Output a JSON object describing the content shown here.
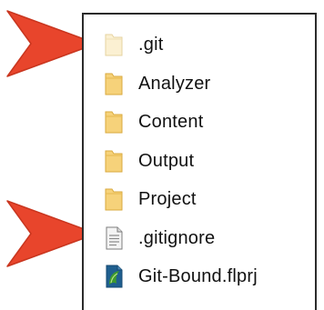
{
  "files": [
    {
      "name": ".git",
      "icon": "folder-hidden-icon"
    },
    {
      "name": "Analyzer",
      "icon": "folder-icon"
    },
    {
      "name": "Content",
      "icon": "folder-icon"
    },
    {
      "name": "Output",
      "icon": "folder-icon"
    },
    {
      "name": "Project",
      "icon": "folder-icon"
    },
    {
      "name": ".gitignore",
      "icon": "text-file-icon"
    },
    {
      "name": "Git-Bound.flprj",
      "icon": "flare-project-icon"
    }
  ],
  "colors": {
    "arrow": "#e8452c",
    "folder": "#f6d27a",
    "folder_hidden": "#fbf0d2",
    "flare_green": "#3f9a2e"
  }
}
